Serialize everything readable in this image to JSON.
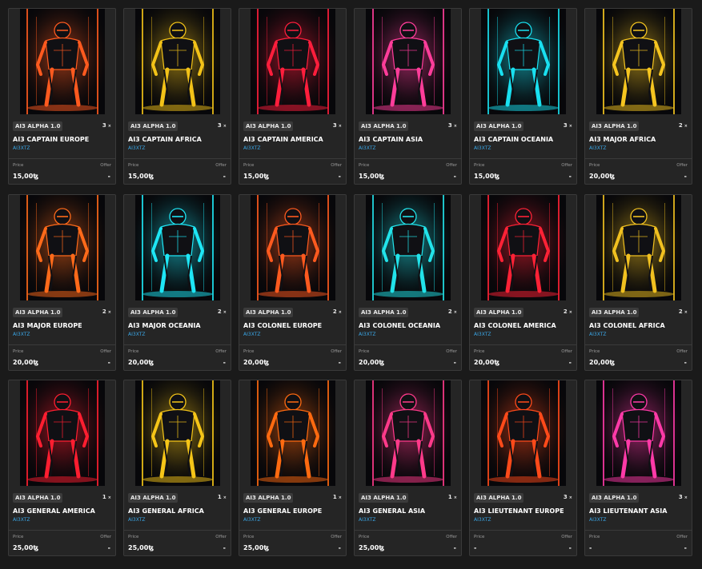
{
  "labels": {
    "price": "Price",
    "offer": "Offer",
    "multiplier": "×"
  },
  "cards": [
    {
      "collection": "AI3 ALPHA 1.0",
      "quantity": "3",
      "name": "AI3 CAPTAIN EUROPE",
      "creator": "AI3XTZ",
      "price": "15,00ꜩ",
      "offer": "-",
      "accent": "#ff5a1f"
    },
    {
      "collection": "AI3 ALPHA 1.0",
      "quantity": "3",
      "name": "AI3 CAPTAIN AFRICA",
      "creator": "AI3XTZ",
      "price": "15,00ꜩ",
      "offer": "-",
      "accent": "#f2c218"
    },
    {
      "collection": "AI3 ALPHA 1.0",
      "quantity": "3",
      "name": "AI3 CAPTAIN AMERICA",
      "creator": "AI3XTZ",
      "price": "15,00ꜩ",
      "offer": "-",
      "accent": "#ff1e3c"
    },
    {
      "collection": "AI3 ALPHA 1.0",
      "quantity": "3",
      "name": "AI3 CAPTAIN ASIA",
      "creator": "AI3XTZ",
      "price": "15,00ꜩ",
      "offer": "-",
      "accent": "#ff3d9a"
    },
    {
      "collection": "AI3 ALPHA 1.0",
      "quantity": "3",
      "name": "AI3 CAPTAIN OCEANIA",
      "creator": "AI3XTZ",
      "price": "15,00ꜩ",
      "offer": "-",
      "accent": "#19e0f0"
    },
    {
      "collection": "AI3 ALPHA 1.0",
      "quantity": "2",
      "name": "AI3 MAJOR AFRICA",
      "creator": "AI3XTZ",
      "price": "20,00ꜩ",
      "offer": "-",
      "accent": "#f5c520"
    },
    {
      "collection": "AI3 ALPHA 1.0",
      "quantity": "2",
      "name": "AI3 MAJOR EUROPE",
      "creator": "AI3XTZ",
      "price": "20,00ꜩ",
      "offer": "-",
      "accent": "#ff6a1a"
    },
    {
      "collection": "AI3 ALPHA 1.0",
      "quantity": "2",
      "name": "AI3 MAJOR OCEANIA",
      "creator": "AI3XTZ",
      "price": "20,00ꜩ",
      "offer": "-",
      "accent": "#1ee6f5"
    },
    {
      "collection": "AI3 ALPHA 1.0",
      "quantity": "2",
      "name": "AI3 COLONEL EUROPE",
      "creator": "AI3XTZ",
      "price": "20,00ꜩ",
      "offer": "-",
      "accent": "#ff5a1f"
    },
    {
      "collection": "AI3 ALPHA 1.0",
      "quantity": "2",
      "name": "AI3 COLONEL OCEANIA",
      "creator": "AI3XTZ",
      "price": "20,00ꜩ",
      "offer": "-",
      "accent": "#22e3ea"
    },
    {
      "collection": "AI3 ALPHA 1.0",
      "quantity": "2",
      "name": "AI3 COLONEL AMERICA",
      "creator": "AI3XTZ",
      "price": "20,00ꜩ",
      "offer": "-",
      "accent": "#ff2236"
    },
    {
      "collection": "AI3 ALPHA 1.0",
      "quantity": "2",
      "name": "AI3 COLONEL AFRICA",
      "creator": "AI3XTZ",
      "price": "20,00ꜩ",
      "offer": "-",
      "accent": "#f0c020"
    },
    {
      "collection": "AI3 ALPHA 1.0",
      "quantity": "1",
      "name": "AI3 GENERAL AMERICA",
      "creator": "AI3XTZ",
      "price": "25,00ꜩ",
      "offer": "-",
      "accent": "#ff1e30"
    },
    {
      "collection": "AI3 ALPHA 1.0",
      "quantity": "1",
      "name": "AI3 GENERAL AFRICA",
      "creator": "AI3XTZ",
      "price": "25,00ꜩ",
      "offer": "-",
      "accent": "#f5c518"
    },
    {
      "collection": "AI3 ALPHA 1.0",
      "quantity": "1",
      "name": "AI3 GENERAL EUROPE",
      "creator": "AI3XTZ",
      "price": "25,00ꜩ",
      "offer": "-",
      "accent": "#ff6a10"
    },
    {
      "collection": "AI3 ALPHA 1.0",
      "quantity": "1",
      "name": "AI3 GENERAL ASIA",
      "creator": "AI3XTZ",
      "price": "25,00ꜩ",
      "offer": "-",
      "accent": "#ff3a8a"
    },
    {
      "collection": "AI3 ALPHA 1.0",
      "quantity": "3",
      "name": "AI3 LIEUTENANT EUROPE",
      "creator": "AI3XTZ",
      "price": "-",
      "offer": "-",
      "accent": "#ff4a1a"
    },
    {
      "collection": "AI3 ALPHA 1.0",
      "quantity": "3",
      "name": "AI3 LIEUTENANT ASIA",
      "creator": "AI3XTZ",
      "price": "-",
      "offer": "-",
      "accent": "#ff3aa8"
    }
  ]
}
